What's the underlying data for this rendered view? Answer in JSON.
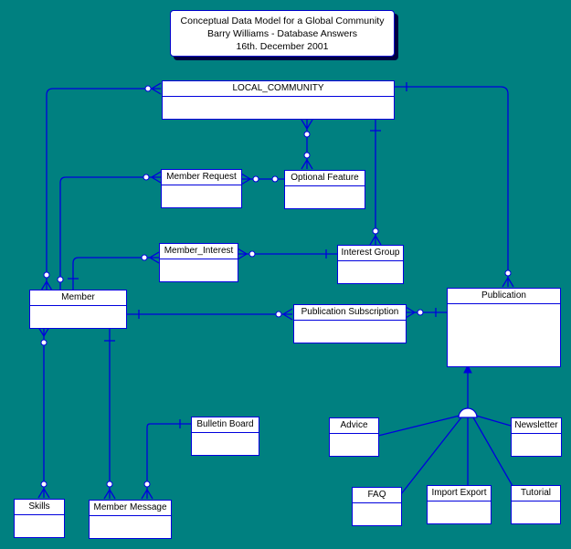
{
  "title": {
    "line1": "Conceptual Data Model for a Global Community",
    "line2": "Barry Williams - Database Answers",
    "line3": "16th. December 2001"
  },
  "colors": {
    "background": "#008080",
    "line": "#0000dd",
    "entity_fill": "#ffffff"
  },
  "entities": {
    "local_community": "LOCAL_COMMUNITY",
    "member_request": "Member Request",
    "optional_feature": "Optional Feature",
    "member_interest": "Member_Interest",
    "interest_group": "Interest Group",
    "member": "Member",
    "publication_subscription": "Publication Subscription",
    "publication": "Publication",
    "bulletin_board": "Bulletin Board",
    "advice": "Advice",
    "newsletter": "Newsletter",
    "skills": "Skills",
    "member_message": "Member Message",
    "faq": "FAQ",
    "import_export": "Import Export",
    "tutorial": "Tutorial"
  }
}
